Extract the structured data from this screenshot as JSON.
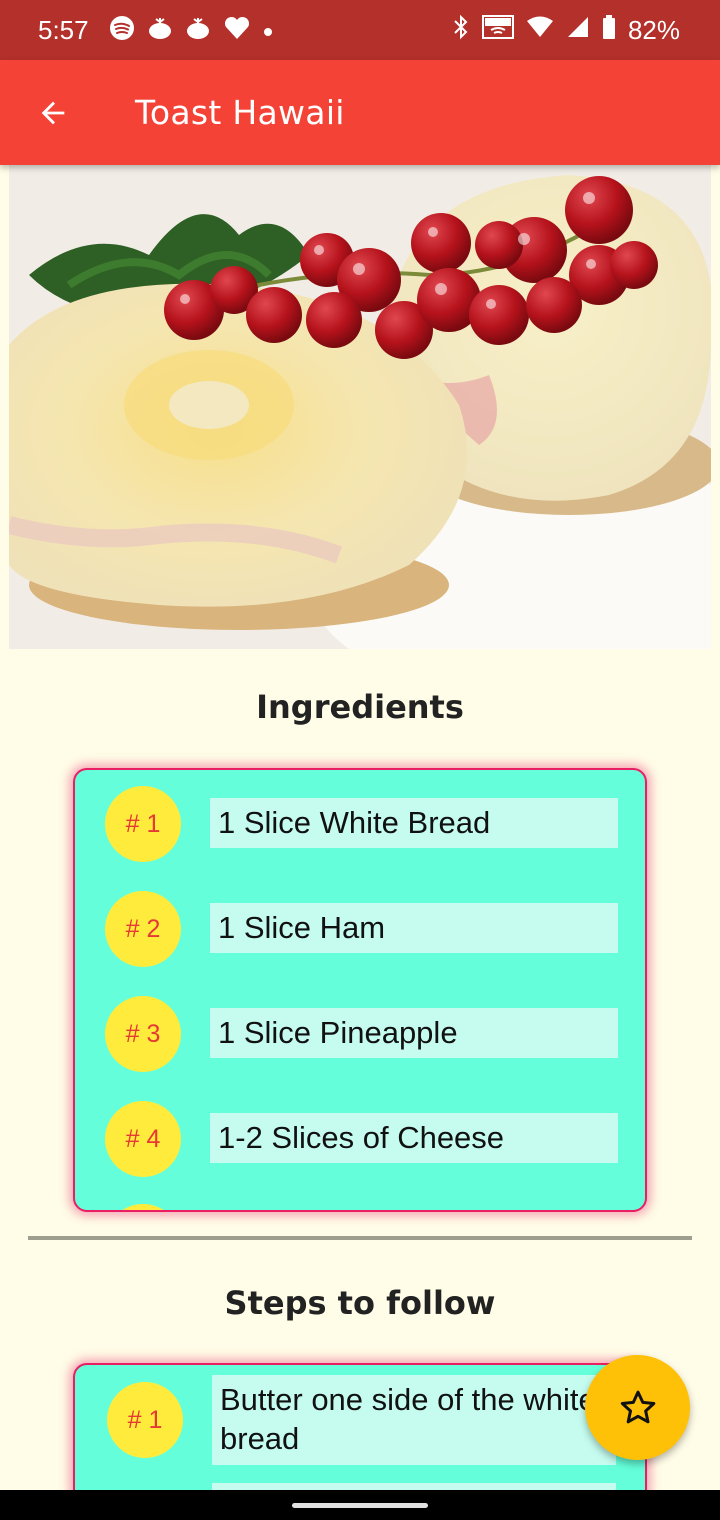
{
  "status_bar": {
    "time": "5:57",
    "battery": "82%",
    "left_icons": [
      "spotify-icon",
      "notification-icon",
      "notification-icon",
      "heart-icon",
      "dot-icon"
    ],
    "right_icons": [
      "bluetooth-icon",
      "vowifi-icon",
      "wifi-icon",
      "signal-icon",
      "battery-icon"
    ]
  },
  "app_bar": {
    "title": "Toast Hawaii",
    "back_icon": "arrow-back-icon"
  },
  "ingredients": {
    "title": "Ingredients",
    "items": [
      {
        "number": "# 1",
        "text": "1 Slice White Bread"
      },
      {
        "number": "# 2",
        "text": "1 Slice Ham"
      },
      {
        "number": "# 3",
        "text": "1 Slice Pineapple"
      },
      {
        "number": "# 4",
        "text": "1-2 Slices of Cheese"
      }
    ]
  },
  "steps": {
    "title": "Steps to follow",
    "items": [
      {
        "number": "# 1",
        "text": "Butter one side of the white bread"
      }
    ]
  },
  "fab": {
    "icon": "star-outline-icon"
  },
  "colors": {
    "status_bar": "#b3302b",
    "app_bar": "#f44336",
    "background": "#fffde7",
    "card": "#64ffda",
    "card_border": "#e91e63",
    "number_circle": "#ffeb3b",
    "number_text": "#e53935",
    "text_box": "#c5fcef",
    "fab": "#ffc107"
  }
}
